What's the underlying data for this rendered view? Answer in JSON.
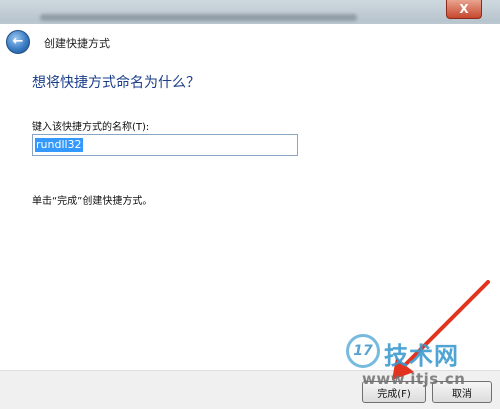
{
  "window": {
    "close_glyph": "X",
    "title": "创建快捷方式"
  },
  "back_icon": "back-arrow-icon",
  "dialog": {
    "heading": "想将快捷方式命名为什么？",
    "field_label": "键入该快捷方式的名称(T):",
    "name_value": "rundll32",
    "hint": "单击“完成”创建快捷方式。"
  },
  "footer": {
    "finish_label": "完成(F)",
    "cancel_label": "取消"
  },
  "watermark": {
    "logo_text": "17",
    "name": "技术网",
    "url": "www.itjs.cn"
  },
  "colors": {
    "heading": "#1a3f8a",
    "selection": "#3399ff",
    "annotation_arrow": "#e2331f"
  }
}
